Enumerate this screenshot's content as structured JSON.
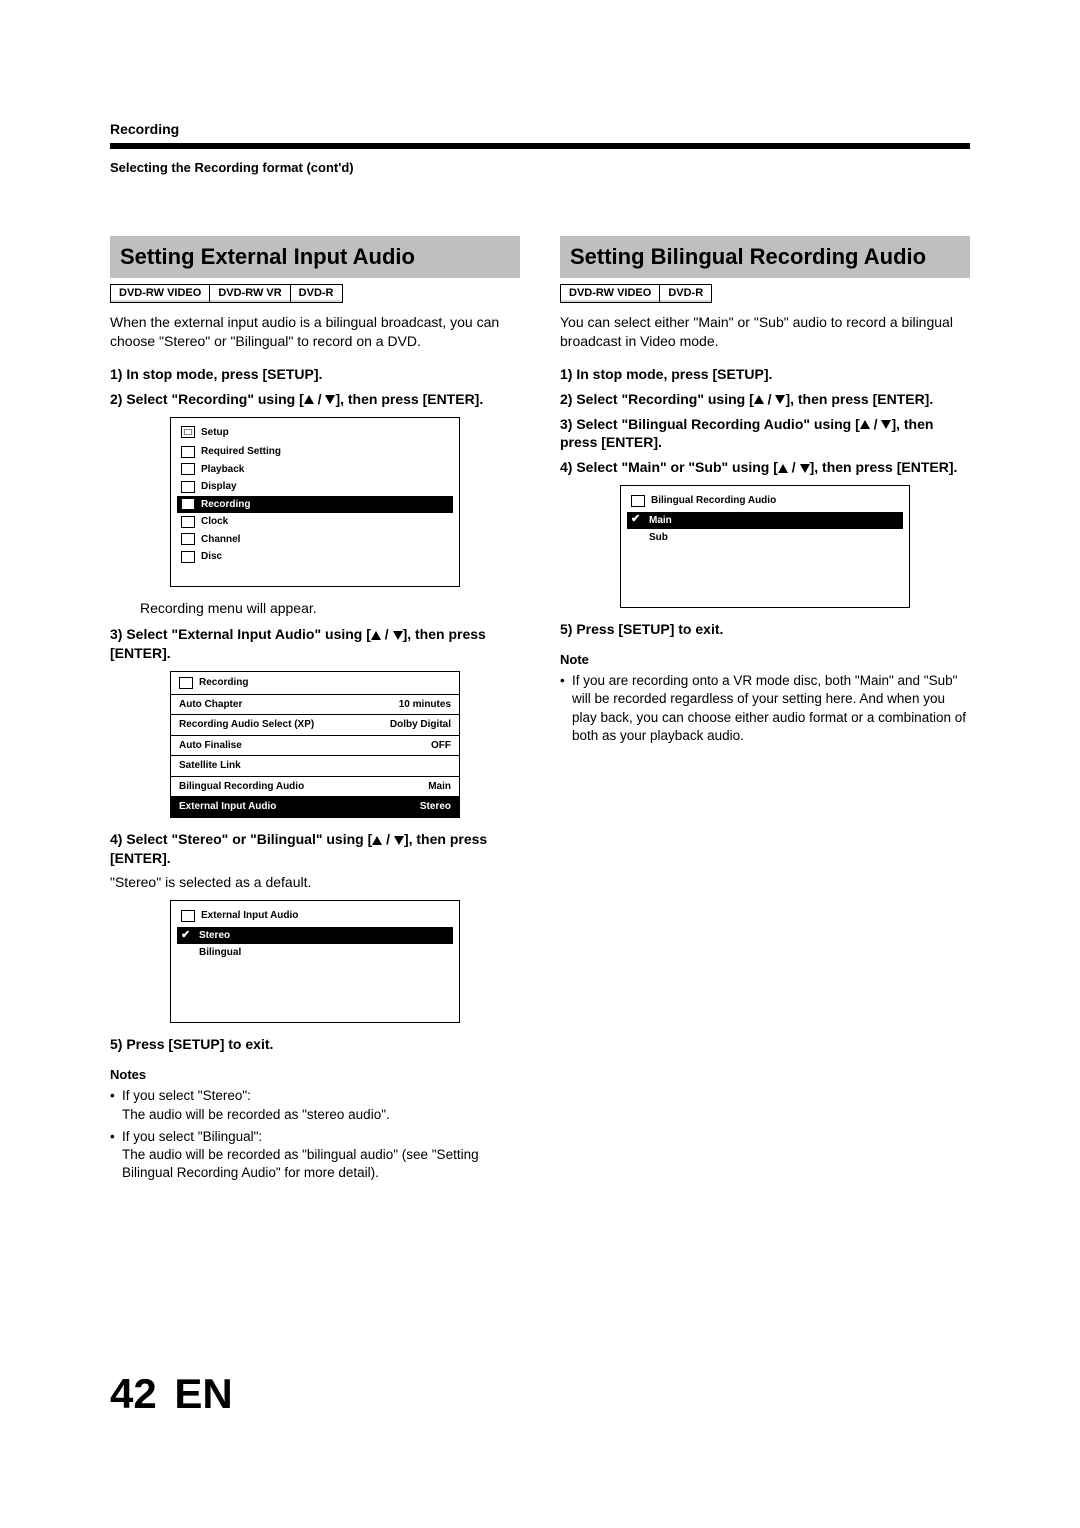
{
  "header": {
    "chapter": "Recording",
    "subheader": "Selecting the Recording format (cont'd)"
  },
  "left": {
    "title": "Setting External Input Audio",
    "formats": [
      "DVD-RW VIDEO",
      "DVD-RW VR",
      "DVD-R"
    ],
    "intro": "When the external input audio is a bilingual broadcast, you can choose \"Stereo\" or \"Bilingual\" to record on a DVD.",
    "steps": {
      "s1": "1) In stop mode, press [SETUP].",
      "s2_a": "2) Select \"Recording\" using [",
      "s2_b": " / ",
      "s2_c": "], then press [ENTER].",
      "s2_note": "Recording menu will appear.",
      "s3_a": "3) Select \"External Input Audio\" using [",
      "s3_b": " / ",
      "s3_c": "], then press [ENTER].",
      "s4_a": "4) Select \"Stereo\" or \"Bilingual\" using [",
      "s4_b": " / ",
      "s4_c": "], then press [ENTER].",
      "s4_note": "\"Stereo\" is selected as a default.",
      "s5": "5) Press [SETUP] to exit."
    },
    "osd_setup": {
      "title": "Setup",
      "items": [
        "Required Setting",
        "Playback",
        "Display",
        "Recording",
        "Clock",
        "Channel",
        "Disc"
      ],
      "highlight_index": 3
    },
    "osd_recording": {
      "title": "Recording",
      "rows": [
        {
          "label": "Auto Chapter",
          "value": "10 minutes"
        },
        {
          "label": "Recording Audio Select (XP)",
          "value": "Dolby Digital"
        },
        {
          "label": "Auto Finalise",
          "value": "OFF"
        },
        {
          "label": "Satellite Link",
          "value": ""
        },
        {
          "label": "Bilingual Recording Audio",
          "value": "Main"
        },
        {
          "label": "External Input Audio",
          "value": "Stereo"
        }
      ],
      "highlight_index": 5
    },
    "osd_ext": {
      "title": "External Input Audio",
      "items": [
        "Stereo",
        "Bilingual"
      ],
      "checked_index": 0,
      "highlight_index": 0
    },
    "notes_head": "Notes",
    "notes": {
      "n1": "If you select \"Stereo\":",
      "n1b": "The audio will be recorded as \"stereo audio\".",
      "n2": "If you select \"Bilingual\":",
      "n2b": "The audio will be recorded as \"bilingual audio\" (see \"Setting Bilingual Recording Audio\" for more detail)."
    }
  },
  "right": {
    "title": "Setting Bilingual Recording Audio",
    "formats": [
      "DVD-RW VIDEO",
      "DVD-R"
    ],
    "intro": "You can select either \"Main\" or \"Sub\" audio to record a bilingual broadcast in Video mode.",
    "steps": {
      "s1": "1) In stop mode, press [SETUP].",
      "s2_a": "2) Select \"Recording\" using [",
      "s2_b": " / ",
      "s2_c": "], then press [ENTER].",
      "s3_a": "3) Select \"Bilingual Recording Audio\" using [",
      "s3_b": " / ",
      "s3_c": "], then press [ENTER].",
      "s4_a": "4) Select \"Main\" or \"Sub\" using [",
      "s4_b": " / ",
      "s4_c": "], then press [ENTER].",
      "s5": "5) Press [SETUP] to exit."
    },
    "osd_bil": {
      "title": "Bilingual Recording Audio",
      "items": [
        "Main",
        "Sub"
      ],
      "checked_index": 0,
      "highlight_index": 0
    },
    "notes_head": "Note",
    "note_text": "If you are recording onto a VR mode disc, both \"Main\" and \"Sub\" will be recorded regardless of your setting here. And when you play back, you can choose either audio format or a combination of both as your playback audio."
  },
  "footer": {
    "page": "42",
    "lang": "EN"
  }
}
